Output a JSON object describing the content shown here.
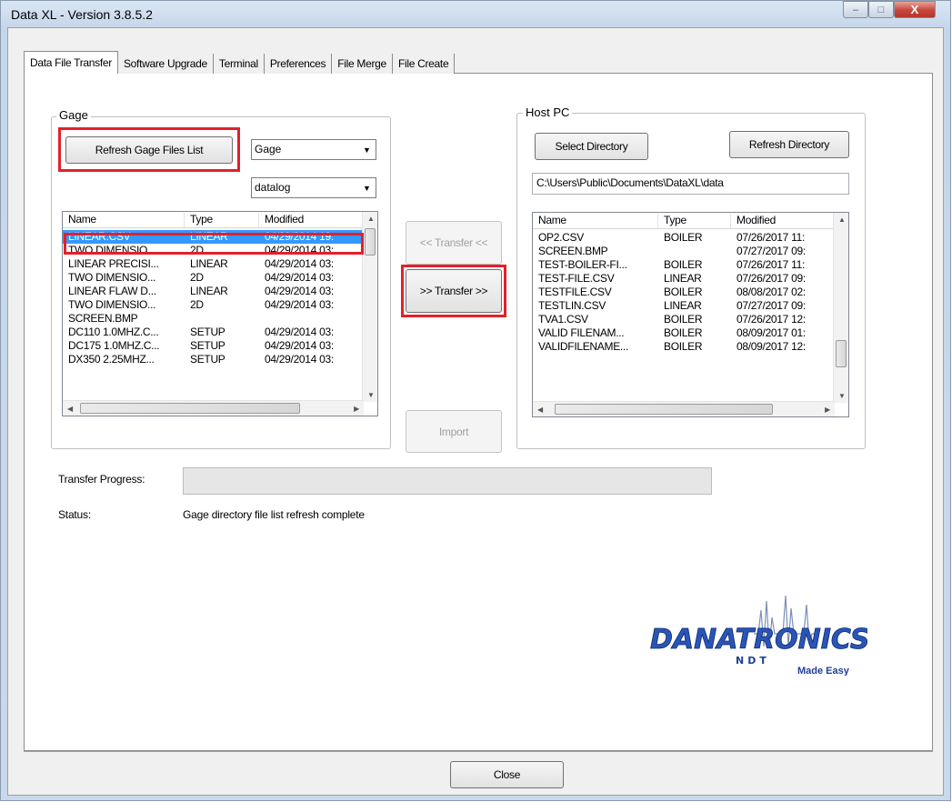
{
  "window": {
    "title": "Data XL - Version 3.8.5.2"
  },
  "caption_buttons": {
    "minimize": "–",
    "maximize": "□",
    "close": "X"
  },
  "tabs": [
    {
      "label": "Data File Transfer",
      "active": true
    },
    {
      "label": "Software Upgrade"
    },
    {
      "label": "Terminal"
    },
    {
      "label": "Preferences"
    },
    {
      "label": "File Merge"
    },
    {
      "label": "File Create"
    }
  ],
  "gage": {
    "group_label": "Gage",
    "refresh_button": "Refresh Gage Files List",
    "device_combo": "Gage",
    "folder_combo": "datalog",
    "columns": [
      "Name",
      "Type",
      "Modified"
    ],
    "rows": [
      {
        "name": "LINEAR.CSV",
        "type": "LINEAR",
        "modified": "04/29/2014 19:",
        "selected": true
      },
      {
        "name": "TWO DIMENSIO...",
        "type": "2D",
        "modified": "04/29/2014 03:"
      },
      {
        "name": "LINEAR PRECISI...",
        "type": "LINEAR",
        "modified": "04/29/2014 03:"
      },
      {
        "name": "TWO DIMENSIO...",
        "type": "2D",
        "modified": "04/29/2014 03:"
      },
      {
        "name": "LINEAR FLAW D...",
        "type": "LINEAR",
        "modified": "04/29/2014 03:"
      },
      {
        "name": "TWO DIMENSIO...",
        "type": "2D",
        "modified": "04/29/2014 03:"
      },
      {
        "name": "SCREEN.BMP",
        "type": "",
        "modified": ""
      },
      {
        "name": "DC110 1.0MHZ.C...",
        "type": "SETUP",
        "modified": "04/29/2014 03:"
      },
      {
        "name": "DC175 1.0MHZ.C...",
        "type": "SETUP",
        "modified": "04/29/2014 03:"
      },
      {
        "name": "DX350 2.25MHZ...",
        "type": "SETUP",
        "modified": "04/29/2014 03:"
      }
    ]
  },
  "transfer": {
    "to_gage": "<< Transfer <<",
    "to_host": ">> Transfer >>",
    "import": "Import"
  },
  "host": {
    "group_label": "Host PC",
    "select_directory": "Select Directory",
    "refresh_directory": "Refresh Directory",
    "path": "C:\\Users\\Public\\Documents\\DataXL\\data",
    "columns": [
      "Name",
      "Type",
      "Modified"
    ],
    "rows": [
      {
        "name": "OP2.CSV",
        "type": "BOILER",
        "modified": "07/26/2017 11:"
      },
      {
        "name": "SCREEN.BMP",
        "type": "",
        "modified": "07/27/2017 09:"
      },
      {
        "name": "TEST-BOILER-FI...",
        "type": "BOILER",
        "modified": "07/26/2017 11:"
      },
      {
        "name": "TEST-FILE.CSV",
        "type": "LINEAR",
        "modified": "07/26/2017 09:"
      },
      {
        "name": "TESTFILE.CSV",
        "type": "BOILER",
        "modified": "08/08/2017 02:"
      },
      {
        "name": "TESTLIN.CSV",
        "type": "LINEAR",
        "modified": "07/27/2017 09:"
      },
      {
        "name": "TVA1.CSV",
        "type": "BOILER",
        "modified": "07/26/2017 12:"
      },
      {
        "name": "VALID FILENAM...",
        "type": "BOILER",
        "modified": "08/09/2017 01:"
      },
      {
        "name": "VALIDFILENAME...",
        "type": "BOILER",
        "modified": "08/09/2017 12:"
      }
    ]
  },
  "progress": {
    "label": "Transfer Progress:",
    "value": 0
  },
  "status": {
    "label": "Status:",
    "text": "Gage directory file list refresh complete"
  },
  "logo": {
    "brand": "DANATRONICS",
    "sub": "NDT",
    "tagline": "Made Easy"
  },
  "close_button": "Close",
  "colors": {
    "selection": "#3399ff",
    "highlight": "#e3202b",
    "logo_blue": "#1f3f9a"
  }
}
